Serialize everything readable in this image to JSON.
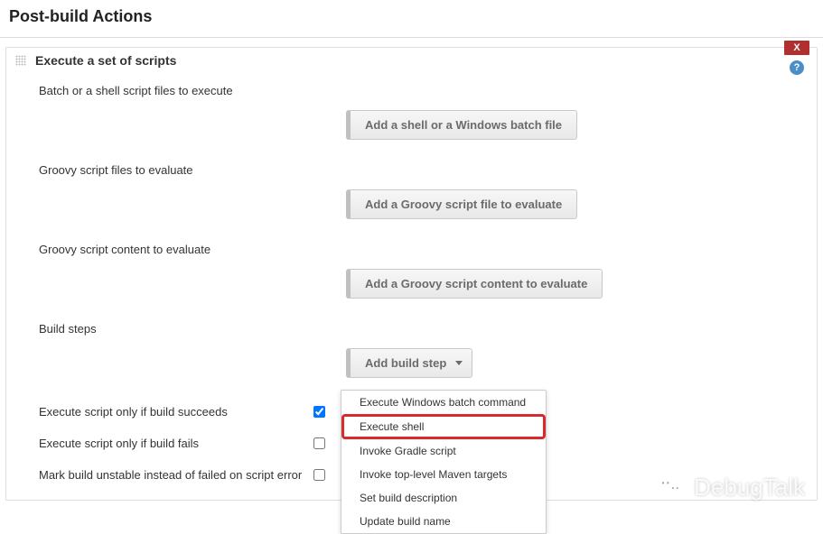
{
  "page": {
    "title": "Post-build Actions"
  },
  "section": {
    "title": "Execute a set of scripts",
    "close_label": "X",
    "help_label": "?"
  },
  "fields": {
    "batch_shell": {
      "label": "Batch or a shell script files to execute",
      "button": "Add a shell or a Windows batch file"
    },
    "groovy_files": {
      "label": "Groovy script files to evaluate",
      "button": "Add a Groovy script file to evaluate"
    },
    "groovy_content": {
      "label": "Groovy script content to evaluate",
      "button": "Add a Groovy script content to evaluate"
    },
    "build_steps": {
      "label": "Build steps",
      "button": "Add build step"
    }
  },
  "checkboxes": {
    "only_success": {
      "label": "Execute script only if build succeeds",
      "checked": true
    },
    "only_fail": {
      "label": "Execute script only if build fails",
      "checked": false
    },
    "mark_unstable": {
      "label": "Mark build unstable instead of failed on script error",
      "checked": false
    }
  },
  "dropdown": {
    "items": [
      "Execute Windows batch command",
      "Execute shell",
      "Invoke Gradle script",
      "Invoke top-level Maven targets",
      "Set build description",
      "Update build name"
    ],
    "highlighted_index": 1
  },
  "watermark": {
    "text": "DebugTalk"
  }
}
